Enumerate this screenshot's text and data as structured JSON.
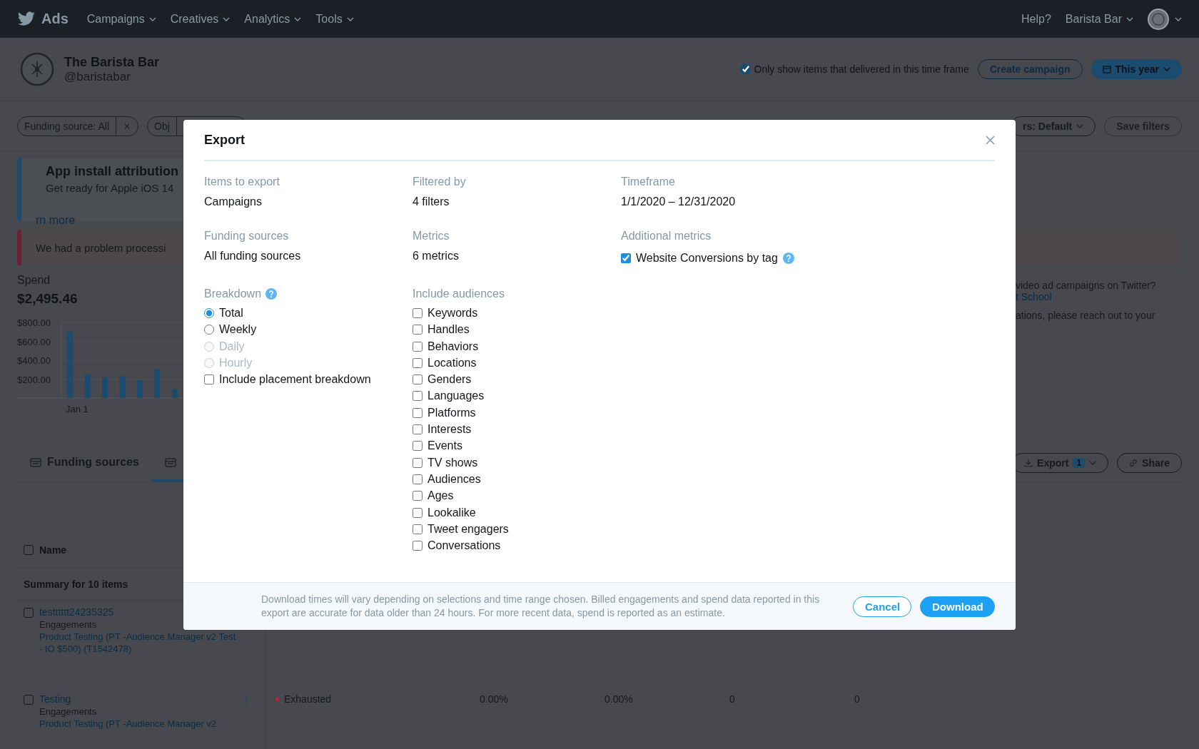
{
  "nav": {
    "brand": "Ads",
    "menus": [
      "Campaigns",
      "Creatives",
      "Analytics",
      "Tools"
    ],
    "help": "Help?",
    "account": "Barista Bar"
  },
  "account": {
    "name": "The Barista Bar",
    "handle": "@baristabar",
    "delivered_filter": {
      "label": "Only show items that delivered in this time frame",
      "checked": true
    },
    "create_button": "Create campaign",
    "timeframe_button": "This year"
  },
  "filters": {
    "chips": [
      "Funding source: All",
      "Obj"
    ],
    "views_button": "rs: Default",
    "save_button": "Save filters"
  },
  "banners": [
    {
      "kind": "info",
      "title": "App install attribution",
      "text": "Get ready for Apple iOS 14",
      "link": "rn more"
    },
    {
      "kind": "error",
      "text": "We had a problem processi"
    }
  ],
  "spend": {
    "label": "Spend",
    "amount": "$2,495.46",
    "date_label": "Jan 1",
    "chart_data": {
      "type": "bar",
      "grid": true,
      "values": [
        705,
        250,
        220,
        233,
        185,
        307,
        98
      ],
      "ylim": [
        0,
        800
      ],
      "yticks": [
        {
          "value": 200,
          "label": "$200.00"
        },
        {
          "value": 400,
          "label": "$400.00"
        },
        {
          "value": 600,
          "label": "$600.00"
        },
        {
          "value": 800,
          "label": "$800.00"
        }
      ]
    }
  },
  "info": {
    "line_1": "video ad campaigns on Twitter?",
    "link": "t School",
    "line_2": "ations, please reach out to your"
  },
  "tabs": [
    {
      "label": "Funding sources",
      "selected": false
    },
    {
      "selected": true
    }
  ],
  "toolbar": {
    "export_label": "Export",
    "export_count": "1",
    "share_label": "Share"
  },
  "table": {
    "select_all_checked": false,
    "name_header": "Name",
    "summary": "Summary for 10 items",
    "rows": [
      {
        "checked": false,
        "name": "testttttt24235325",
        "objective": "Engagements",
        "funding_source": "Product Testing (PT -Audience Manager v2 Test - IO $500) (T1542478)"
      },
      {
        "checked": false,
        "name": "Testing",
        "objective": "Engagements",
        "funding_source": "Product Testing (PT -Audience Manager v2",
        "status": "Exhausted",
        "color": "#c0203f",
        "cells": [
          "0.00%",
          "0.00%",
          "0",
          "0"
        ]
      }
    ]
  },
  "modal": {
    "title": "Export",
    "fields": [
      {
        "kind": "text",
        "label": "Items to export",
        "value": "Campaigns"
      },
      {
        "kind": "text",
        "label": "Filtered by",
        "value": "4 filters"
      },
      {
        "kind": "text",
        "label": "Timeframe",
        "value": "1/1/2020 – 12/31/2020"
      },
      {
        "kind": "text",
        "label": "Funding sources",
        "value": "All funding sources"
      },
      {
        "kind": "text",
        "label": "Metrics",
        "value": "6 metrics"
      },
      {
        "kind": "checkbox",
        "label": "Additional metrics",
        "value": "Website Conversions by tag",
        "checked": true
      }
    ],
    "breakdown": {
      "label": "Breakdown",
      "options": [
        {
          "label": "Total",
          "selected": true,
          "disabled": false
        },
        {
          "label": "Weekly",
          "selected": false,
          "disabled": false
        },
        {
          "label": "Daily",
          "selected": false,
          "disabled": true
        },
        {
          "label": "Hourly",
          "selected": false,
          "disabled": true
        }
      ],
      "placement": {
        "label": "Include placement breakdown",
        "checked": false
      }
    },
    "audiences": {
      "label": "Include audiences",
      "items": [
        {
          "label": "Keywords",
          "checked": false
        },
        {
          "label": "Handles",
          "checked": false
        },
        {
          "label": "Behaviors",
          "checked": false
        },
        {
          "label": "Locations",
          "checked": false
        },
        {
          "label": "Genders",
          "checked": false
        },
        {
          "label": "Languages",
          "checked": false
        },
        {
          "label": "Platforms",
          "checked": false
        },
        {
          "label": "Interests",
          "checked": false
        },
        {
          "label": "Events",
          "checked": false
        },
        {
          "label": "TV shows",
          "checked": false
        },
        {
          "label": "Audiences",
          "checked": false
        },
        {
          "label": "Ages",
          "checked": false
        },
        {
          "label": "Lookalike",
          "checked": false
        },
        {
          "label": "Tweet engagers",
          "checked": false
        },
        {
          "label": "Conversations",
          "checked": false
        }
      ]
    },
    "note": "Download times will vary depending on selections and time range chosen. Billed engagements and spend data reported in this export are accurate for data older than 24 hours. For more recent data, spend is reported as an estimate.",
    "buttons": [
      {
        "kind": "secondary",
        "label": "Cancel"
      },
      {
        "kind": "primary",
        "label": "Download"
      }
    ]
  }
}
